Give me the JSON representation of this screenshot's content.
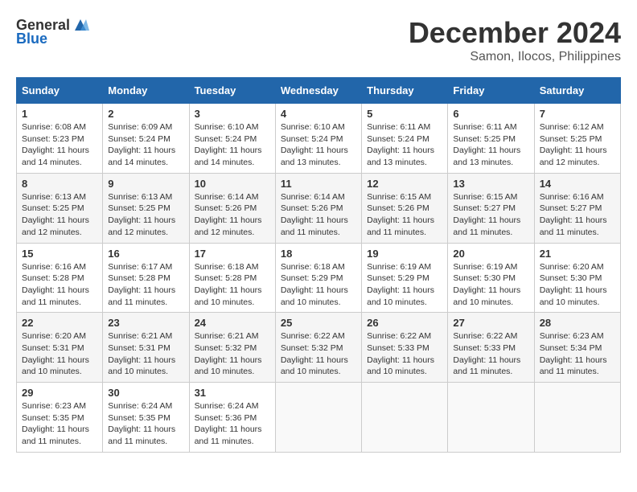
{
  "logo": {
    "general": "General",
    "blue": "Blue"
  },
  "title": "December 2024",
  "location": "Samon, Ilocos, Philippines",
  "days_of_week": [
    "Sunday",
    "Monday",
    "Tuesday",
    "Wednesday",
    "Thursday",
    "Friday",
    "Saturday"
  ],
  "weeks": [
    [
      {
        "day": "1",
        "sunrise": "6:08 AM",
        "sunset": "5:23 PM",
        "daylight": "11 hours and 14 minutes."
      },
      {
        "day": "2",
        "sunrise": "6:09 AM",
        "sunset": "5:24 PM",
        "daylight": "11 hours and 14 minutes."
      },
      {
        "day": "3",
        "sunrise": "6:10 AM",
        "sunset": "5:24 PM",
        "daylight": "11 hours and 14 minutes."
      },
      {
        "day": "4",
        "sunrise": "6:10 AM",
        "sunset": "5:24 PM",
        "daylight": "11 hours and 13 minutes."
      },
      {
        "day": "5",
        "sunrise": "6:11 AM",
        "sunset": "5:24 PM",
        "daylight": "11 hours and 13 minutes."
      },
      {
        "day": "6",
        "sunrise": "6:11 AM",
        "sunset": "5:25 PM",
        "daylight": "11 hours and 13 minutes."
      },
      {
        "day": "7",
        "sunrise": "6:12 AM",
        "sunset": "5:25 PM",
        "daylight": "11 hours and 12 minutes."
      }
    ],
    [
      {
        "day": "8",
        "sunrise": "6:13 AM",
        "sunset": "5:25 PM",
        "daylight": "11 hours and 12 minutes."
      },
      {
        "day": "9",
        "sunrise": "6:13 AM",
        "sunset": "5:25 PM",
        "daylight": "11 hours and 12 minutes."
      },
      {
        "day": "10",
        "sunrise": "6:14 AM",
        "sunset": "5:26 PM",
        "daylight": "11 hours and 12 minutes."
      },
      {
        "day": "11",
        "sunrise": "6:14 AM",
        "sunset": "5:26 PM",
        "daylight": "11 hours and 11 minutes."
      },
      {
        "day": "12",
        "sunrise": "6:15 AM",
        "sunset": "5:26 PM",
        "daylight": "11 hours and 11 minutes."
      },
      {
        "day": "13",
        "sunrise": "6:15 AM",
        "sunset": "5:27 PM",
        "daylight": "11 hours and 11 minutes."
      },
      {
        "day": "14",
        "sunrise": "6:16 AM",
        "sunset": "5:27 PM",
        "daylight": "11 hours and 11 minutes."
      }
    ],
    [
      {
        "day": "15",
        "sunrise": "6:16 AM",
        "sunset": "5:28 PM",
        "daylight": "11 hours and 11 minutes."
      },
      {
        "day": "16",
        "sunrise": "6:17 AM",
        "sunset": "5:28 PM",
        "daylight": "11 hours and 11 minutes."
      },
      {
        "day": "17",
        "sunrise": "6:18 AM",
        "sunset": "5:28 PM",
        "daylight": "11 hours and 10 minutes."
      },
      {
        "day": "18",
        "sunrise": "6:18 AM",
        "sunset": "5:29 PM",
        "daylight": "11 hours and 10 minutes."
      },
      {
        "day": "19",
        "sunrise": "6:19 AM",
        "sunset": "5:29 PM",
        "daylight": "11 hours and 10 minutes."
      },
      {
        "day": "20",
        "sunrise": "6:19 AM",
        "sunset": "5:30 PM",
        "daylight": "11 hours and 10 minutes."
      },
      {
        "day": "21",
        "sunrise": "6:20 AM",
        "sunset": "5:30 PM",
        "daylight": "11 hours and 10 minutes."
      }
    ],
    [
      {
        "day": "22",
        "sunrise": "6:20 AM",
        "sunset": "5:31 PM",
        "daylight": "11 hours and 10 minutes."
      },
      {
        "day": "23",
        "sunrise": "6:21 AM",
        "sunset": "5:31 PM",
        "daylight": "11 hours and 10 minutes."
      },
      {
        "day": "24",
        "sunrise": "6:21 AM",
        "sunset": "5:32 PM",
        "daylight": "11 hours and 10 minutes."
      },
      {
        "day": "25",
        "sunrise": "6:22 AM",
        "sunset": "5:32 PM",
        "daylight": "11 hours and 10 minutes."
      },
      {
        "day": "26",
        "sunrise": "6:22 AM",
        "sunset": "5:33 PM",
        "daylight": "11 hours and 10 minutes."
      },
      {
        "day": "27",
        "sunrise": "6:22 AM",
        "sunset": "5:33 PM",
        "daylight": "11 hours and 11 minutes."
      },
      {
        "day": "28",
        "sunrise": "6:23 AM",
        "sunset": "5:34 PM",
        "daylight": "11 hours and 11 minutes."
      }
    ],
    [
      {
        "day": "29",
        "sunrise": "6:23 AM",
        "sunset": "5:35 PM",
        "daylight": "11 hours and 11 minutes."
      },
      {
        "day": "30",
        "sunrise": "6:24 AM",
        "sunset": "5:35 PM",
        "daylight": "11 hours and 11 minutes."
      },
      {
        "day": "31",
        "sunrise": "6:24 AM",
        "sunset": "5:36 PM",
        "daylight": "11 hours and 11 minutes."
      },
      null,
      null,
      null,
      null
    ]
  ]
}
